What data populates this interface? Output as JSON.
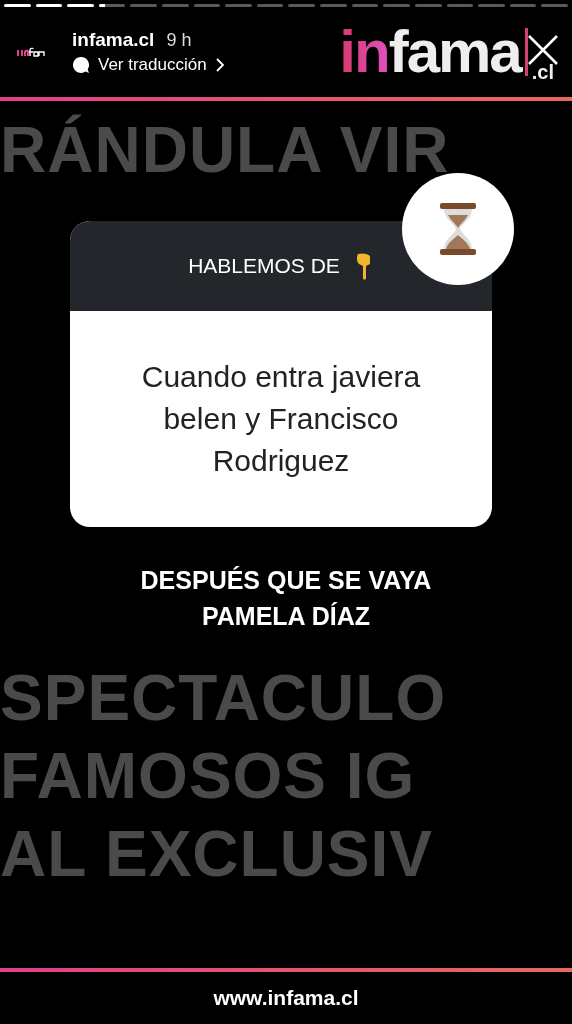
{
  "progress": [
    {
      "level": 1
    },
    {
      "level": 1
    },
    {
      "level": 1
    },
    {
      "level": 0.25
    },
    {
      "level": 0
    },
    {
      "level": 0
    },
    {
      "level": 0
    },
    {
      "level": 0
    },
    {
      "level": 0
    },
    {
      "level": 0
    },
    {
      "level": 0
    },
    {
      "level": 0
    },
    {
      "level": 0
    },
    {
      "level": 0
    },
    {
      "level": 0
    },
    {
      "level": 0
    },
    {
      "level": 0
    },
    {
      "level": 0
    }
  ],
  "header": {
    "account": "infama.cl",
    "time": "9 h",
    "translate": "Ver traducción",
    "logo": {
      "accent": "in",
      "main": "fama",
      "suffix": ".cl"
    }
  },
  "background_words_top": [
    "RÁNDULA VIR"
  ],
  "background_words_bottom": [
    "SPECTACULO",
    "FAMOSOS IG",
    "AL EXCLUSIV"
  ],
  "question_card": {
    "title": "HABLEMOS DE",
    "answer": "Cuando entra javiera belen y Francisco Rodriguez"
  },
  "caption": [
    "DESPUÉS QUE SE VAYA",
    "PAMELA DÍAZ"
  ],
  "footer": {
    "url": "www.infama.cl"
  }
}
